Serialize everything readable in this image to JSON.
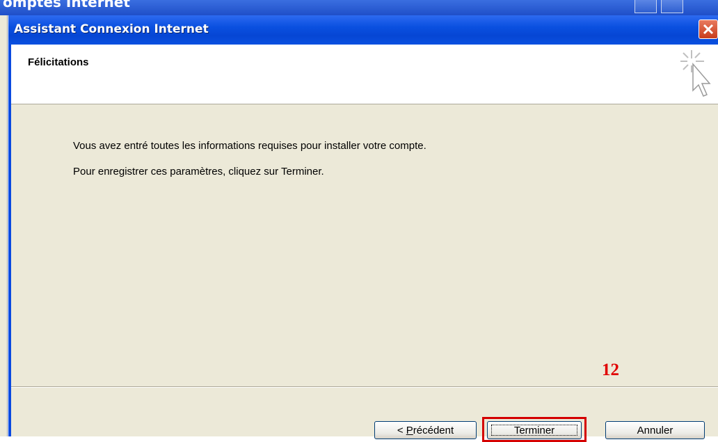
{
  "background_window": {
    "title_fragment": "omptes Internet"
  },
  "dialog": {
    "title": "Assistant Connexion Internet",
    "header_title": "Félicitations",
    "messages": [
      "Vous avez entré toutes les informations requises pour installer votre compte.",
      "Pour enregistrer ces paramètres, cliquez sur Terminer."
    ],
    "buttons": {
      "back_prefix": "< ",
      "back_accel": "P",
      "back_rest": "récédent",
      "finish": "Terminer",
      "cancel": "Annuler"
    }
  },
  "annotation": {
    "step_number": "12",
    "color": "#d40000"
  },
  "icons": {
    "close": "close-icon",
    "wizard": "wizard-cursor-icon"
  },
  "colors": {
    "titlebar": "#0a50e0",
    "dialog_bg": "#ece9d8",
    "header_bg": "#ffffff",
    "close_button": "#c83c1c"
  }
}
